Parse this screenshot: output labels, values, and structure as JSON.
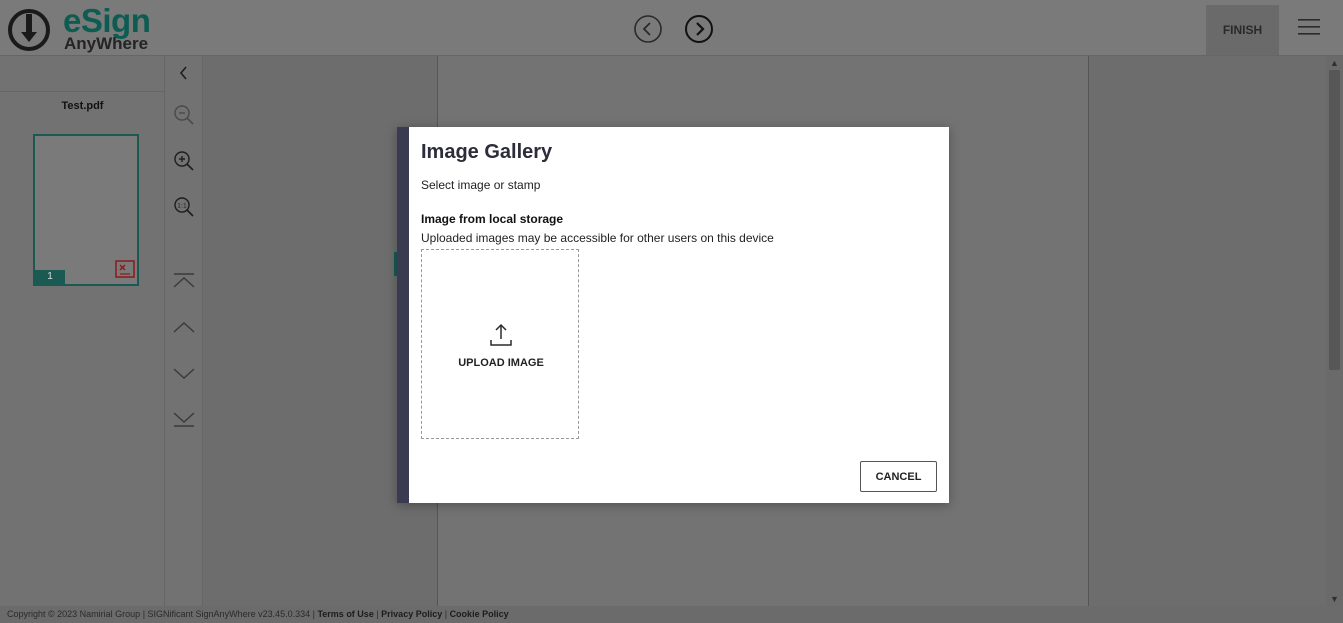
{
  "header": {
    "logo_main": "eSign",
    "logo_sub": "AnyWhere",
    "prev_icon": "chevron-left-circle-icon",
    "next_icon": "chevron-right-circle-icon",
    "finish_label": "FINISH",
    "menu_icon": "hamburger-menu-icon"
  },
  "sidebar": {
    "collapse_icon": "chevron-left-icon",
    "file_name": "Test.pdf",
    "page_number": "1",
    "tools": [
      {
        "name": "zoom-out-icon"
      },
      {
        "name": "zoom-in-icon"
      },
      {
        "name": "zoom-actual-size-icon"
      },
      {
        "name": "first-page-icon"
      },
      {
        "name": "previous-page-icon"
      },
      {
        "name": "next-page-icon"
      },
      {
        "name": "last-page-icon"
      }
    ]
  },
  "modal": {
    "title": "Image Gallery",
    "subtitle": "Select image or stamp",
    "section_title": "Image from local storage",
    "section_desc": "Uploaded images may be accessible for other users on this device",
    "upload_label": "UPLOAD IMAGE",
    "cancel_label": "CANCEL"
  },
  "footer": {
    "copyright": "Copyright © 2023 Namirial Group | SIGNificant SignAnyWhere v23.45.0.334 | ",
    "terms": "Terms of Use",
    "privacy": "Privacy Policy",
    "cookie": "Cookie Policy",
    "separator": " | "
  },
  "colors": {
    "brand_green": "#0d5c52",
    "modal_accent": "#3a3a50",
    "overlay": "#6f6f6f"
  }
}
